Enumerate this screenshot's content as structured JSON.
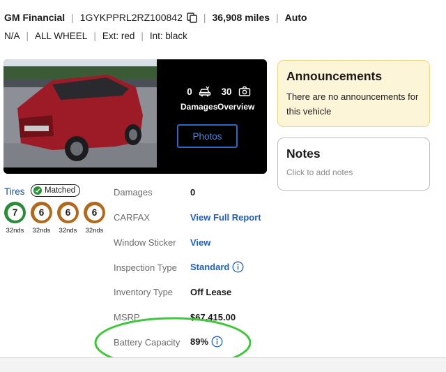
{
  "header": {
    "seller": "GM Financial",
    "vin": "1GYKPPRL2RZ100842",
    "mileage": "36,908 miles",
    "transmission": "Auto",
    "engine": "N/A",
    "drivetrain": "ALL WHEEL",
    "exterior": "Ext: red",
    "interior": "Int: black",
    "copy_icon": "copy-icon"
  },
  "media": {
    "damages_count": "0",
    "damages_label": "Damages",
    "overview_count": "30",
    "overview_label": "Overview",
    "photos_button": "Photos",
    "car_color": "#b41e2c"
  },
  "announcements": {
    "title": "Announcements",
    "text": "There are no announcements for this vehicle"
  },
  "notes": {
    "title": "Notes",
    "hint": "Click to add notes"
  },
  "tires": {
    "label": "Tires",
    "badge": "Matched",
    "items": [
      {
        "value": "7",
        "tread": "32nds",
        "status_color": "#2c8a3b"
      },
      {
        "value": "6",
        "tread": "32nds",
        "status_color": "#b06a1e"
      },
      {
        "value": "6",
        "tread": "32nds",
        "status_color": "#b06a1e"
      },
      {
        "value": "6",
        "tread": "32nds",
        "status_color": "#b06a1e"
      }
    ]
  },
  "details": {
    "damages": {
      "label": "Damages",
      "value": "0"
    },
    "carfax": {
      "label": "CARFAX",
      "value": "View Full Report"
    },
    "window_sticker": {
      "label": "Window Sticker",
      "value": "View"
    },
    "inspection_type": {
      "label": "Inspection Type",
      "value": "Standard"
    },
    "inventory_type": {
      "label": "Inventory Type",
      "value": "Off Lease"
    },
    "msrp": {
      "label": "MSRP",
      "value": "$67,415.00"
    },
    "battery_capacity": {
      "label": "Battery Capacity",
      "value": "89%"
    }
  },
  "colors": {
    "link_blue": "#1f5fb8",
    "annotation_green": "#3dc73a",
    "announcement_bg": "#fdf5d8"
  }
}
